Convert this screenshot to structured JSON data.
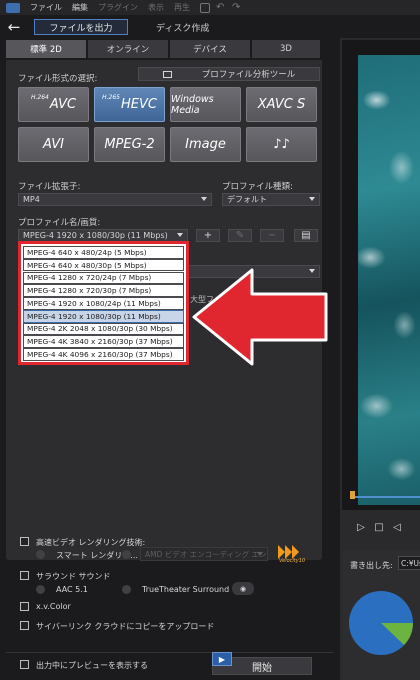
{
  "menu": {
    "items": [
      "ファイル",
      "編集",
      "プラグイン",
      "表示",
      "再生"
    ],
    "dim_items": [
      false,
      false,
      true,
      true,
      true
    ]
  },
  "top": {
    "back_icon": "back-arrow-icon",
    "tab_output": "ファイルを出力",
    "tab_disc": "ディスク作成"
  },
  "subtabs": [
    "標準 2D",
    "オンライン",
    "デバイス",
    "3D"
  ],
  "format": {
    "select_label": "ファイル形式の選択:",
    "analyzer_button": "プロファイル分析ツール",
    "buttons": [
      {
        "prefix": "H.264",
        "label": "AVC",
        "selected": false
      },
      {
        "prefix": "H.265",
        "label": "HEVC",
        "selected": true
      },
      {
        "prefix": "",
        "label": "Windows Media",
        "selected": false
      },
      {
        "prefix": "",
        "label": "XAVC S",
        "selected": false
      },
      {
        "prefix": "",
        "label": "AVI",
        "selected": false
      },
      {
        "prefix": "",
        "label": "MPEG-2",
        "selected": false
      },
      {
        "prefix": "",
        "label": "Image",
        "selected": false
      },
      {
        "prefix": "",
        "label": "♪♪",
        "selected": false
      }
    ]
  },
  "ext": {
    "label": "ファイル拡張子:",
    "value": "MP4"
  },
  "ptype": {
    "label": "プロファイル種類:",
    "value": "デフォルト"
  },
  "profile": {
    "label": "プロファイル名/画質:",
    "value": "MPEG-4 1920 x 1080/30p (11 Mbps)",
    "options": [
      "MPEG-4 640 x 480/24p (5 Mbps)",
      "MPEG-4 640 x 480/30p (5 Mbps)",
      "MPEG-4 1280 x 720/24p (7 Mbps)",
      "MPEG-4 1280 x 720/30p (7 Mbps)",
      "MPEG-4 1920 x 1080/24p (11 Mbps)",
      "MPEG-4 1920 x 1080/30p (11 Mbps)",
      "MPEG-4 2K 2048 x 1080/30p (30 Mbps)",
      "MPEG-4 4K 3840 x 2160/30p (37 Mbps)",
      "MPEG-4 4K 4096 x 2160/30p (37 Mbps)"
    ],
    "highlighted_index": 5
  },
  "hidden_text": "大型フ",
  "options": {
    "hw_accel": "高速ビデオ レンダリング技術:",
    "smart_render": "スマート レンダリン...",
    "hw_encoder": "AMD ビデオ エンコーディング エン",
    "velocity": "Velocity10",
    "surround": "サラウンド サウンド",
    "aac": "AAC 5.1",
    "truetheater": "TrueTheater Surround",
    "xvcolor": "x.v.Color",
    "cyberlink_cloud": "サイバーリンク クラウドにコピーをアップロード"
  },
  "bottom": {
    "preview_label": "出力中にプレビューを表示する",
    "start_button": "開始"
  },
  "right": {
    "dest_label": "書き出し先:",
    "dest_value": "C:¥Us"
  },
  "colors": {
    "accent": "#3c6bb0",
    "annotation_red": "#e0262f",
    "pie_blue": "#2a6fc0",
    "pie_green": "#6db33f"
  }
}
